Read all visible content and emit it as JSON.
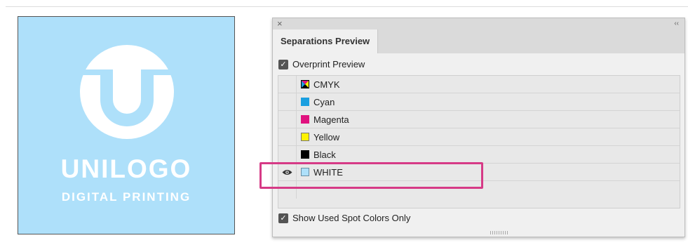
{
  "artwork": {
    "brand_name": "UNILOGO",
    "tagline": "DIGITAL PRINTING",
    "background_color": "#aee0fa",
    "logo_color": "#ffffff",
    "logo_icon": "u-circle-logo-icon"
  },
  "panel": {
    "tab_title": "Separations Preview",
    "close_icon": "×",
    "collapse_icon": "‹‹",
    "overprint_preview": {
      "label": "Overprint Preview",
      "checked": true
    },
    "show_used_spot_colors_only": {
      "label": "Show Used Spot Colors Only",
      "checked": true
    },
    "inks": [
      {
        "label": "CMYK",
        "swatch": "cmyk",
        "color": "#000000",
        "visible": false
      },
      {
        "label": "Cyan",
        "swatch": "solid",
        "color": "#1a9fe0",
        "visible": false
      },
      {
        "label": "Magenta",
        "swatch": "solid",
        "color": "#e0127f",
        "visible": false
      },
      {
        "label": "Yellow",
        "swatch": "solid",
        "color": "#fff200",
        "visible": false
      },
      {
        "label": "Black",
        "swatch": "solid",
        "color": "#000000",
        "visible": false
      },
      {
        "label": "WHITE",
        "swatch": "solid",
        "color": "#aee0fa",
        "visible": true
      }
    ]
  },
  "highlight_color": "#d63a86"
}
